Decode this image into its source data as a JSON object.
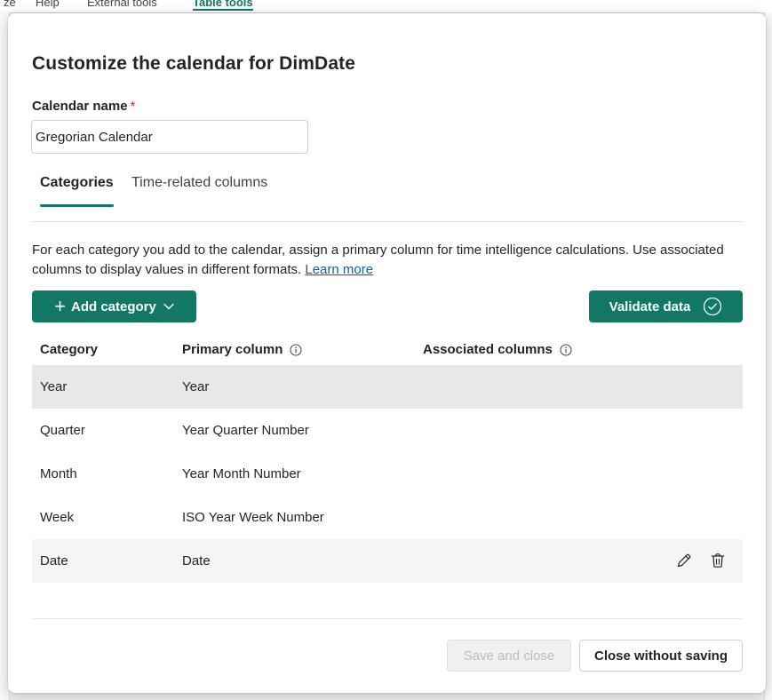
{
  "background": {
    "ribbon_tabs": [
      {
        "label": "ze",
        "active": false
      },
      {
        "label": "Help",
        "active": false
      },
      {
        "label": "External tools",
        "active": false
      },
      {
        "label": "Table tools",
        "active": true
      }
    ]
  },
  "dialog": {
    "title": "Customize the calendar for DimDate",
    "calendar_name": {
      "label": "Calendar name",
      "required_mark": "*",
      "value": "Gregorian Calendar"
    },
    "tabs": [
      {
        "label": "Categories",
        "active": true
      },
      {
        "label": "Time-related columns",
        "active": false
      }
    ],
    "description": {
      "text": "For each category you add to the calendar, assign a primary column for time intelligence calculations. Use associated columns to display values in different formats.",
      "link_text": "Learn more"
    },
    "add_category_label": "Add category",
    "validate_label": "Validate data",
    "table": {
      "headers": {
        "category": "Category",
        "primary": "Primary column",
        "associated": "Associated columns"
      },
      "rows": [
        {
          "category": "Year",
          "primary": "Year",
          "associated": "",
          "state": "selected"
        },
        {
          "category": "Quarter",
          "primary": "Year Quarter Number",
          "associated": "",
          "state": "normal"
        },
        {
          "category": "Month",
          "primary": "Year Month Number",
          "associated": "",
          "state": "normal"
        },
        {
          "category": "Week",
          "primary": "ISO Year Week Number",
          "associated": "",
          "state": "normal"
        },
        {
          "category": "Date",
          "primary": "Date",
          "associated": "",
          "state": "hovered"
        }
      ]
    },
    "footer": {
      "save_label": "Save and close",
      "close_label": "Close without saving"
    }
  },
  "colors": {
    "accent": "#117865",
    "selected_row": "#e8e8e8",
    "hovered_row": "#f5f5f5",
    "required": "#c4314b",
    "link": "#115ea3"
  },
  "icons": {
    "add": "plus-icon",
    "dropdown": "chevron-down-icon",
    "validate": "checkmark-circle-icon",
    "info": "info-icon",
    "edit": "pencil-icon",
    "delete": "trash-icon"
  }
}
